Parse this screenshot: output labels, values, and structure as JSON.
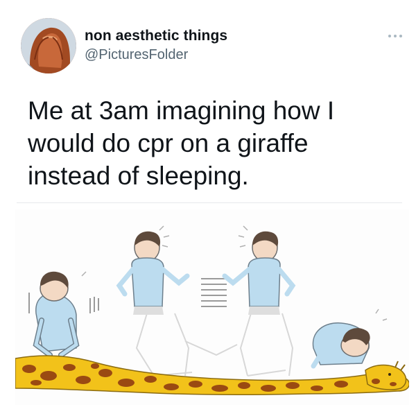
{
  "tweet": {
    "author": {
      "display_name": "non aesthetic things",
      "handle": "@PicturesFolder"
    },
    "more_icon": "ellipsis-icon",
    "text": "Me at 3am imagining how I\nwould do cpr on a giraffe\ninstead of sleeping.",
    "media": {
      "description_icon": "illustration",
      "colors": {
        "giraffe_yellow": "#f2c21a",
        "giraffe_spot": "#9a4a12",
        "shirt_blue": "#bcdcef",
        "hair_brown": "#5e4a3c"
      }
    }
  }
}
